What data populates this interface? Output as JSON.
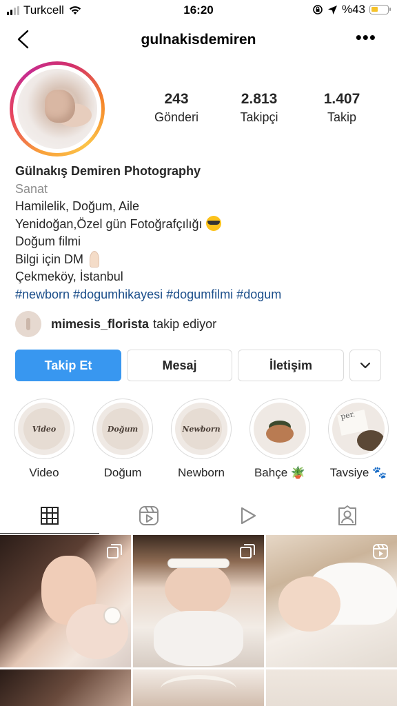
{
  "status_bar": {
    "carrier": "Turkcell",
    "time": "16:20",
    "battery": "%43",
    "battery_level": 0.43
  },
  "header": {
    "username": "gulnakisdemiren",
    "more": "•••"
  },
  "profile": {
    "stats": [
      {
        "value": "243",
        "label": "Gönderi"
      },
      {
        "value": "2.813",
        "label": "Takipçi"
      },
      {
        "value": "1.407",
        "label": "Takip"
      }
    ],
    "name": "Gülnakış Demiren Photography",
    "category": "Sanat",
    "bio_lines": [
      "Hamilelik, Doğum, Aile",
      "Yenidoğan,Özel gün Fotoğrafçılığı",
      "Doğum filmi",
      "Bilgi için DM",
      "Çekmeköy, İstanbul"
    ],
    "hashtags": "#newborn #dogumhikayesi #dogumfilmi #dogum",
    "followed_by": {
      "user": "mimesis_florista",
      "text": "takip ediyor"
    }
  },
  "actions": {
    "follow": "Takip Et",
    "message": "Mesaj",
    "contact": "İletişim"
  },
  "highlights": [
    {
      "label": "Video",
      "cover_text": "Video"
    },
    {
      "label": "Doğum",
      "cover_text": "Doğum"
    },
    {
      "label": "Newborn",
      "cover_text": "Newborn"
    },
    {
      "label": "Bahçe 🪴",
      "cover_text": ""
    },
    {
      "label": "Tavsiye 🐾",
      "cover_text": "per."
    }
  ],
  "tabs": [
    {
      "icon": "grid-icon",
      "active": true
    },
    {
      "icon": "reels-icon",
      "active": false
    },
    {
      "icon": "video-icon",
      "active": false
    },
    {
      "icon": "tagged-icon",
      "active": false
    }
  ],
  "grid": [
    {
      "type": "carousel"
    },
    {
      "type": "carousel"
    },
    {
      "type": "reel"
    },
    {
      "type": "photo"
    },
    {
      "type": "photo"
    },
    {
      "type": "photo"
    }
  ],
  "colors": {
    "follow_button": "#3897f0",
    "hashtag": "#1b4e8a",
    "battery": "#f5c22b"
  }
}
